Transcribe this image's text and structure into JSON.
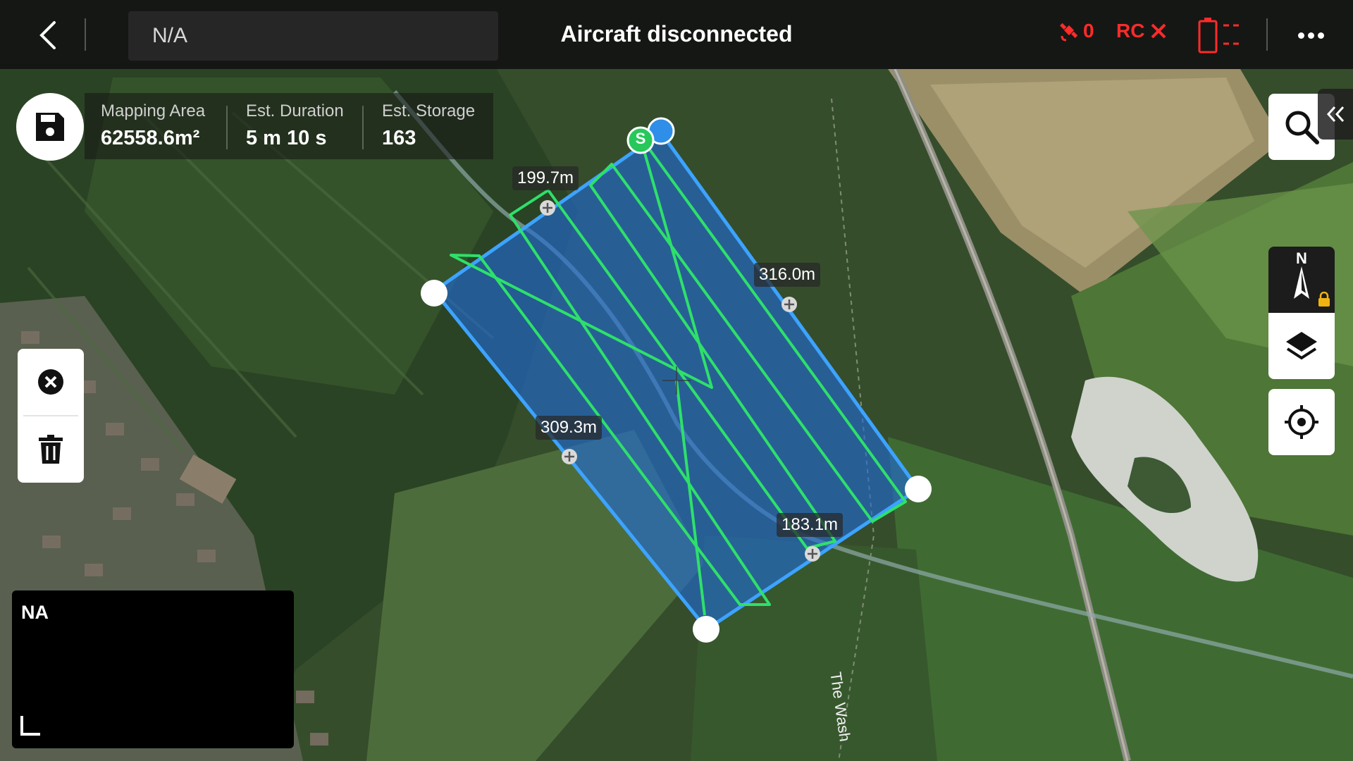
{
  "header": {
    "back_icon": "chevron-left-icon",
    "device_name": "N/A",
    "title": "Aircraft disconnected",
    "gps_count": "0",
    "rc_label": "RC",
    "status_color": "#ff2b2b",
    "more_icon": "more-dots-icon"
  },
  "mapping": {
    "save_icon": "save-icon",
    "stats": [
      {
        "label": "Mapping Area",
        "value": "62558.6m²"
      },
      {
        "label": "Est. Duration",
        "value": "5 m 10 s"
      },
      {
        "label": "Est. Storage",
        "value": "163"
      }
    ]
  },
  "distances": [
    "199.7m",
    "316.0m",
    "309.3m",
    "183.1m"
  ],
  "start_marker": "S",
  "map_labels": {
    "road": "The Wash"
  },
  "compass": {
    "north": "N"
  },
  "minimap": {
    "label": "NA"
  },
  "colors": {
    "area_fill": "#1f6bd6",
    "area_border": "#3da3ff",
    "route": "#2ee06a",
    "start": "#27c85a"
  }
}
